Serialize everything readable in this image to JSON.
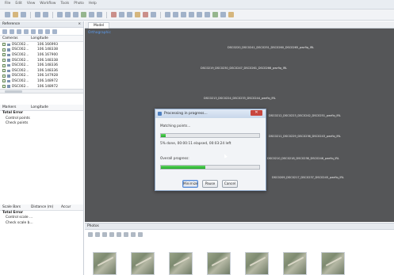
{
  "menu": [
    "File",
    "Edit",
    "View",
    "Workflow",
    "Tools",
    "Photo",
    "Help"
  ],
  "reference_panel": {
    "title": "Reference",
    "close": "×",
    "columns": [
      "Cameras",
      "Longitude"
    ],
    "cameras": [
      {
        "name": "DSC002...",
        "longitude": "106.166993"
      },
      {
        "name": "DSC002...",
        "longitude": "106.148338"
      },
      {
        "name": "DSC002...",
        "longitude": "106.167900"
      },
      {
        "name": "DSC002...",
        "longitude": "106.148338"
      },
      {
        "name": "DSC002...",
        "longitude": "106.148336"
      },
      {
        "name": "DSC002...",
        "longitude": "106.148336"
      },
      {
        "name": "DSC002...",
        "longitude": "106.147928"
      },
      {
        "name": "DSC002...",
        "longitude": "106.148972"
      },
      {
        "name": "DSC002...",
        "longitude": "106.148972"
      }
    ],
    "markers_columns": [
      "Markers",
      "Longitude"
    ],
    "markers_rows": [
      {
        "text": "Total Error",
        "bold": true
      },
      {
        "text": "Control points",
        "bold": false
      },
      {
        "text": "Check points",
        "bold": false
      }
    ],
    "scale_columns": [
      "Scale Bars",
      "Distance (m)",
      "Accur"
    ],
    "scale_rows": [
      {
        "text": "Total Error",
        "bold": true
      },
      {
        "text": "Control scale ...",
        "bold": false
      },
      {
        "text": "Check scale b...",
        "bold": false
      }
    ]
  },
  "model": {
    "tab": "Model",
    "view_label": "Orthographic",
    "camera_labels": [
      "DSC0220_DSC0241_DSC0251_DSC0260_DSC0265_pwrfiq_IRL",
      "DSC0219_DSC0230_DSC0247_DSC0261_DSC0266_pwrfiq_IRL",
      "DSC0213_DSC0224_DSC0233_DSC0244_pwrfiq_IRL",
      "DSC0212_DSC0223_DSC0242_DSC0251_pwrfiq_IRL",
      "DSC0211_DSC0229_DSC0236_DSC0243_pwrfiq_IRL",
      "DSC0210_DSC0218_DSC0238_DSC0246_pwrfiq_IRL",
      "DSC0209_DSC0217_DSC0237_DSC0245_pwrfiq_IRL"
    ]
  },
  "dialog": {
    "title": "Processing in progress...",
    "close": "✕",
    "step": "Matching points...",
    "step_progress": 0.05,
    "step_status": "5% done, 00:00:11 elapsed, 00:03:24 left",
    "overall_label": "Overall progress:",
    "overall_progress": 0.45,
    "buttons": [
      "Minimize",
      "Pause",
      "Cancel"
    ]
  },
  "photos": {
    "title": "Photos",
    "thumb_count": 7
  },
  "colors": {
    "model_bg": "#555658",
    "progress_green": "#22a92a",
    "accent_blue": "#5b9cf0"
  }
}
